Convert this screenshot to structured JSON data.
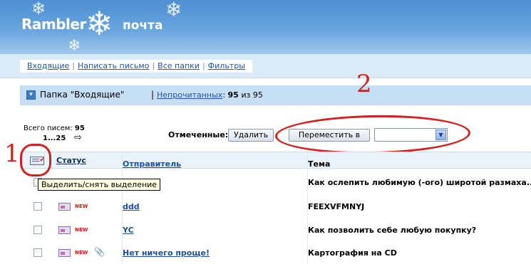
{
  "brand": {
    "name": "Rambler",
    "service": "почта"
  },
  "nav": {
    "links": [
      "Входящие",
      "Написать письмо",
      "Все папки",
      "Фильтры"
    ]
  },
  "folder": {
    "title": "Папка \"Входящие\"",
    "unread_label": "Непрочитанных",
    "unread_count": "95",
    "of_label": "из",
    "total": "95"
  },
  "summary": {
    "total_label": "Всего писем:",
    "total_count": "95",
    "page_range": "1...25",
    "next_arrow": "⇨"
  },
  "actions": {
    "marked_label": "Отмеченные:",
    "delete_label": "Удалить",
    "move_label": "Переместить в",
    "move_target": ""
  },
  "annotations": {
    "one": "1",
    "two": "2",
    "accent_color": "#d42020"
  },
  "table": {
    "headers": {
      "status": "Статус",
      "sender": "Отправитель",
      "subject": "Тема"
    },
    "select_all_tooltip": "Выделить/снять выделение",
    "rows": [
      {
        "new": "",
        "attachment": false,
        "sender": "",
        "subject": "Как ослепить любимую (-ого) широтой размаха..."
      },
      {
        "new": "NEW",
        "attachment": false,
        "sender": "ddd",
        "subject": "FEEXVFMNYJ"
      },
      {
        "new": "NEW",
        "attachment": false,
        "sender": "YC",
        "subject": "Как позволить себе любую покупку?"
      },
      {
        "new": "NEW",
        "attachment": true,
        "sender": "Нет ничего проще!",
        "subject": "Картография на CD"
      }
    ]
  },
  "colors": {
    "header_blue": "#4e8fd3",
    "link_blue": "#2057a6",
    "folder_bar": "#c7dff5"
  }
}
